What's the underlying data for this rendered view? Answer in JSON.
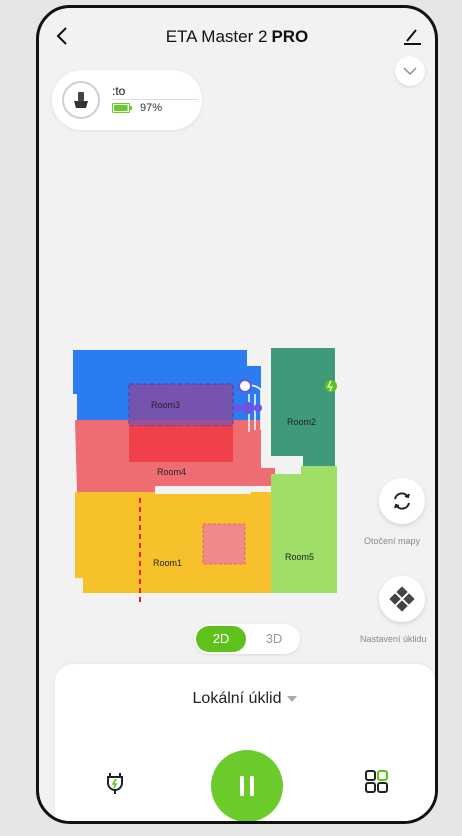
{
  "header": {
    "title": "ETA Master 2",
    "title_suffix": "PRO"
  },
  "status": {
    "name": ":to",
    "battery_text": "97%",
    "battery_level": 0.97
  },
  "map": {
    "rooms": [
      {
        "name": "Room1",
        "color": "#f6c12a"
      },
      {
        "name": "Room2",
        "color": "#3f9a7a"
      },
      {
        "name": "Room3",
        "color": "#2a7cf0"
      },
      {
        "name": "Room4",
        "color": "#ee6d72"
      },
      {
        "name": "Room5",
        "color": "#9fde69"
      }
    ]
  },
  "side_buttons": {
    "rotate_label": "Otočení mapy",
    "settings_label": "Nastavení úklidu"
  },
  "view_toggle": {
    "option_2d": "2D",
    "option_3d": "3D",
    "selected": "2D"
  },
  "bottom_panel": {
    "mode_label": "Lokální úklid"
  },
  "colors": {
    "accent": "#6bcb2a",
    "background": "#f2f2f2"
  },
  "icons": [
    "back-icon",
    "edit-icon",
    "chevron-down-icon",
    "robot-broom-icon",
    "battery-icon",
    "rotate-map-icon",
    "cleaning-settings-icon",
    "dock-charge-icon",
    "pause-icon",
    "rooms-grid-icon"
  ]
}
